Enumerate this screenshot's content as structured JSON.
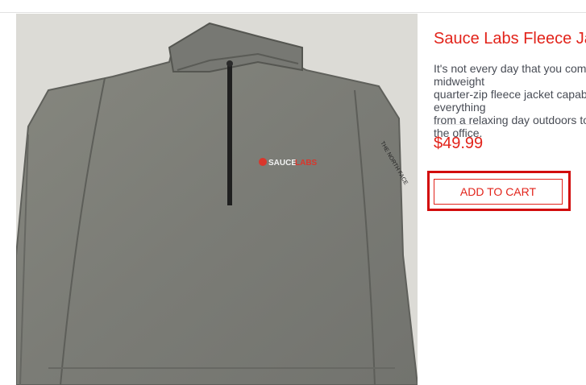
{
  "product": {
    "name": "Sauce Labs Fleece Jacket",
    "description": "It's not every day that you come across a midweight\nquarter-zip fleece jacket capable of handling everything\nfrom a relaxing day outdoors to a busy day at the office.",
    "price": "$49.99",
    "add_to_cart_label": "ADD TO CART",
    "image": {
      "alt": "Sauce Labs Fleece Jacket",
      "logo_text_left": "SAUCE",
      "logo_text_right": "LABS",
      "sleeve_text": "THE NORTH FACE"
    }
  },
  "colors": {
    "accent": "#e2231a",
    "highlight_outline": "#d20c0c",
    "body_text": "#484c55",
    "jacket": "#7d7e79"
  }
}
